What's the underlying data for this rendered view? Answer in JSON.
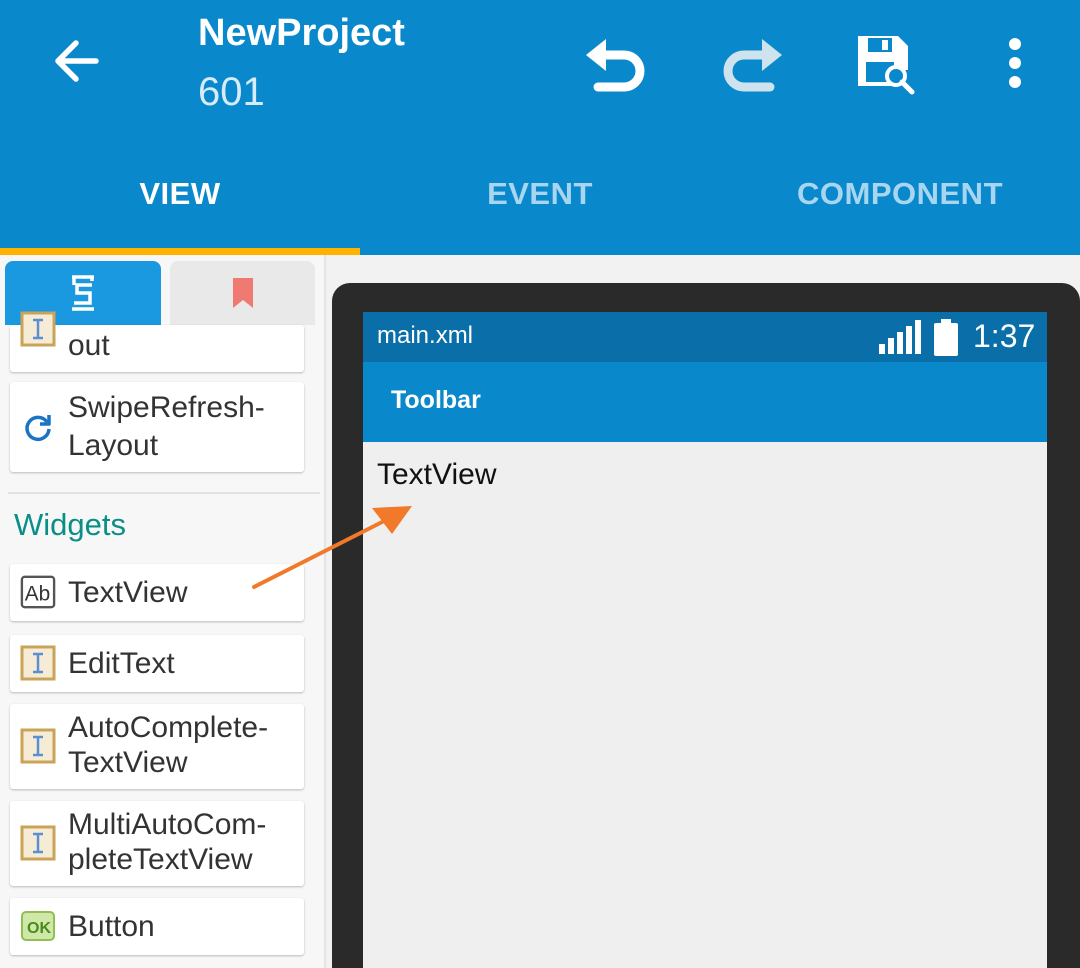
{
  "header": {
    "title": "NewProject",
    "subtitle": "601",
    "actions": {
      "back": "arrow-back-icon",
      "undo": "undo-icon",
      "redo": "redo-icon",
      "save": "save-icon",
      "more": "more-vert-icon"
    }
  },
  "tabs": [
    {
      "label": "VIEW",
      "selected": true
    },
    {
      "label": "EVENT",
      "selected": false
    },
    {
      "label": "COMPONENT",
      "selected": false
    }
  ],
  "palette": {
    "tabs": [
      {
        "icon": "widget-palette-icon",
        "selected": true
      },
      {
        "icon": "bookmark-icon",
        "selected": false
      }
    ],
    "layouts": [
      {
        "label": "out",
        "icon": "layout-icon"
      },
      {
        "label": "SwipeRefresh-\nLayout",
        "icon": "refresh-icon"
      }
    ],
    "widgets_section": "Widgets",
    "widgets": [
      {
        "label": "TextView",
        "icon": "textview-icon"
      },
      {
        "label": "EditText",
        "icon": "edittext-icon"
      },
      {
        "label": "AutoComplete-\nTextView",
        "icon": "edittext-icon"
      },
      {
        "label": "MultiAutoCom-\npleteTextView",
        "icon": "edittext-icon"
      },
      {
        "label": "Button",
        "icon": "button-icon"
      }
    ]
  },
  "preview": {
    "file_name": "main.xml",
    "time": "1:37",
    "toolbar_title": "Toolbar",
    "textview_text": "TextView"
  },
  "colors": {
    "primary": "#0a88cc",
    "status": "#0a6fa8",
    "accent_indicator": "#ffb300",
    "section_text": "#0a8f86",
    "drag_arrow": "#f07a2a"
  }
}
